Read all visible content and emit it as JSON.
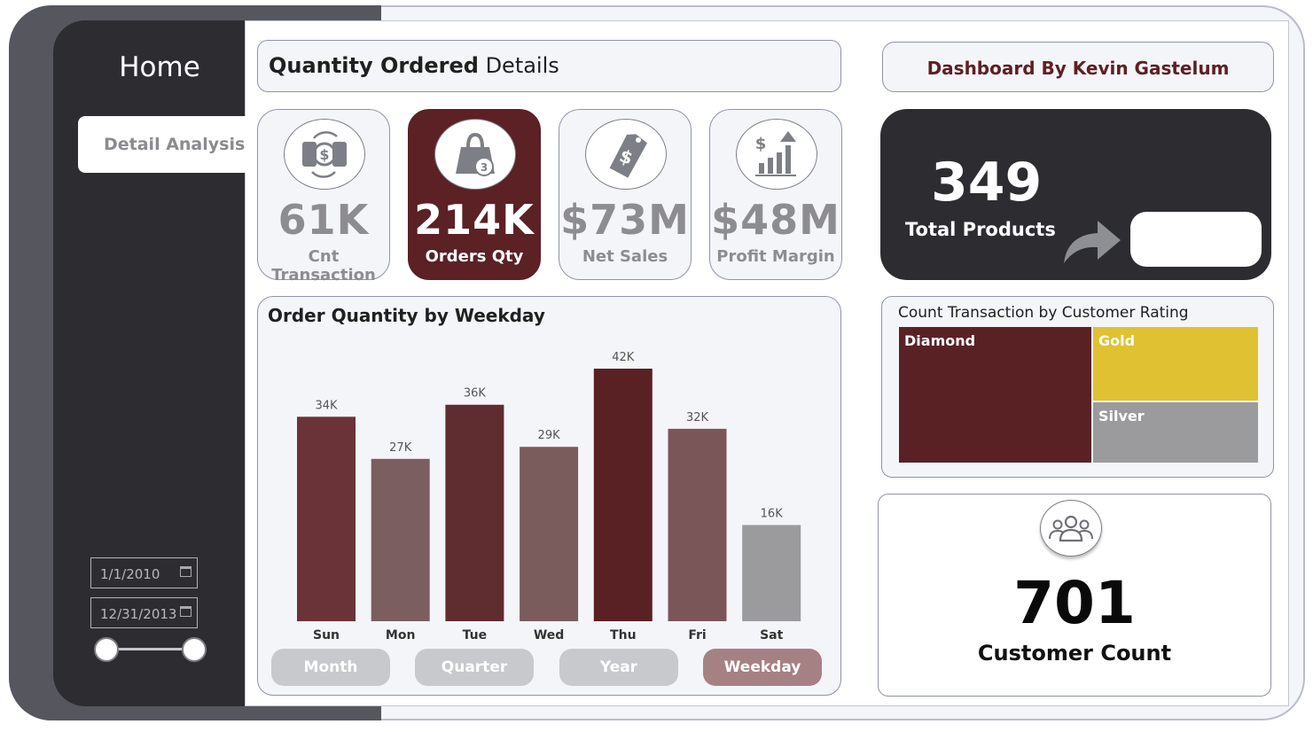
{
  "nav": {
    "home_label": "Home",
    "detail_tab_label": "Detail Analysis"
  },
  "date_range": {
    "start": "1/1/2010",
    "end": "12/31/2013"
  },
  "header": {
    "title_bold": "Quantity Ordered",
    "title_rest": " Details",
    "author": "Dashboard By Kevin Gastelum"
  },
  "kpis": [
    {
      "value": "61K",
      "label": "Cnt Transaction",
      "icon": "money-exchange-icon",
      "active": false
    },
    {
      "value": "214K",
      "label": "Orders Qty",
      "icon": "shopping-bag-icon",
      "active": true
    },
    {
      "value": "$73M",
      "label": "Net Sales",
      "icon": "price-tag-icon",
      "active": false
    },
    {
      "value": "$48M",
      "label": "Profit Margin",
      "icon": "growth-chart-icon",
      "active": false
    }
  ],
  "totals": {
    "value": "349",
    "label": "Total Products"
  },
  "treemap": {
    "title": "Count Transaction by Customer Rating",
    "tiles": [
      {
        "label": "Diamond",
        "color": "#5a2125"
      },
      {
        "label": "Gold",
        "color": "#e0c132"
      },
      {
        "label": "Silver",
        "color": "#9b9b9d"
      }
    ]
  },
  "customers": {
    "value": "701",
    "label": "Customer Count"
  },
  "buttons": [
    {
      "label": "Month",
      "selected": false
    },
    {
      "label": "Quarter",
      "selected": false
    },
    {
      "label": "Year",
      "selected": false
    },
    {
      "label": "Weekday",
      "selected": true
    }
  ],
  "colors": {
    "accent": "#5b2125",
    "sidebar": "#2d2d31",
    "panel": "#f4f5f9"
  },
  "chart_data": {
    "type": "bar",
    "title": "Order Quantity by Weekday",
    "categories": [
      "Sun",
      "Mon",
      "Tue",
      "Wed",
      "Thu",
      "Fri",
      "Sat"
    ],
    "values": [
      34,
      27,
      36,
      29,
      42,
      32,
      16
    ],
    "value_labels": [
      "34K",
      "27K",
      "36K",
      "29K",
      "42K",
      "32K",
      "16K"
    ],
    "colors": [
      "#6a3337",
      "#7b5e5f",
      "#5f2c30",
      "#7a5c5d",
      "#5a2125",
      "#7b5659",
      "#9b9b9d"
    ],
    "unit": "K",
    "ylim": [
      0,
      42
    ],
    "grid": false,
    "legend": "none"
  }
}
